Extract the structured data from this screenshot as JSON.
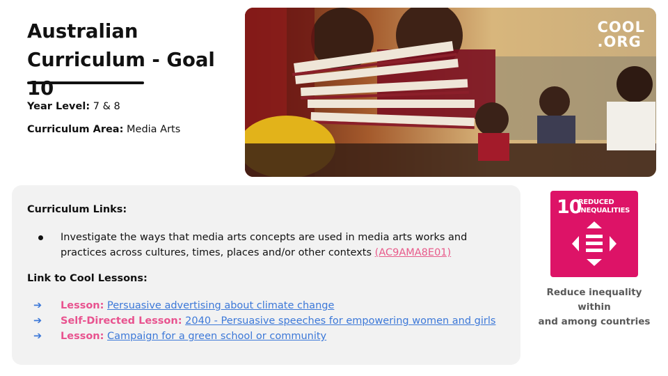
{
  "header": {
    "title_lines": [
      "Australian",
      "Curriculum - Goal 10"
    ],
    "year_level_label": "Year Level:",
    "year_level_value": "7 & 8",
    "curriculum_area_label": "Curriculum Area:",
    "curriculum_area_value": "Media Arts"
  },
  "logo": {
    "line1": "COOL",
    "line2": ".ORG"
  },
  "curriculum_links": {
    "heading": "Curriculum Links:",
    "items": [
      {
        "text": "Investigate the ways that media arts concepts are used in media arts works and practices across cultures, times, places and/or other contexts ",
        "code": "(AC9AMA8E01)"
      }
    ]
  },
  "cool_lessons": {
    "heading": "Link to Cool Lessons:",
    "arrow": "➔",
    "items": [
      {
        "label": "Lesson:",
        "link": "Persuasive advertising about climate change"
      },
      {
        "label": "Self-Directed Lesson:",
        "link": "2040 - Persuasive speeches for empowering women and girls"
      },
      {
        "label": "Lesson:",
        "link": "Campaign for a green school or community"
      }
    ]
  },
  "sdg": {
    "number": "10",
    "label_lines": [
      "REDUCED",
      "INEQUALITIES"
    ],
    "color": "#dd1367",
    "icon": "equality-arrows-icon",
    "caption_lines": [
      "Reduce inequality within",
      "and among countries"
    ]
  },
  "colors": {
    "lesson_label": "#e8538f",
    "link": "#3c78d8",
    "code_link": "#e85a8a",
    "panel": "#f2f2f2"
  }
}
